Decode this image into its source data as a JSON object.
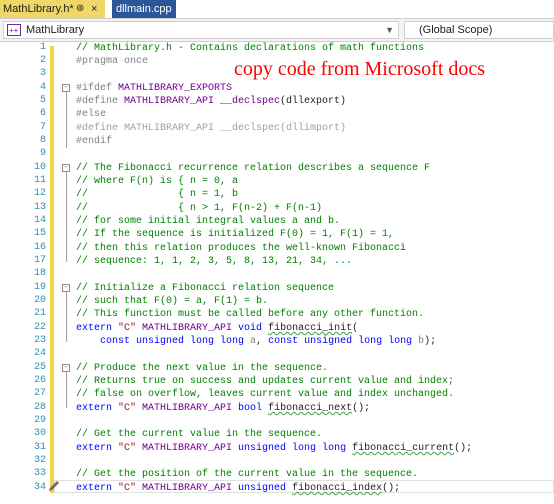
{
  "tabs": [
    {
      "label": "MathLibrary.h*",
      "active": true
    },
    {
      "label": "dllmain.cpp",
      "active": false
    }
  ],
  "nav": {
    "project": "MathLibrary",
    "scope": "(Global Scope)"
  },
  "annotation": "copy code from Microsoft docs",
  "line_numbers": [
    "1",
    "2",
    "3",
    "4",
    "5",
    "6",
    "7",
    "8",
    "9",
    "10",
    "11",
    "12",
    "13",
    "14",
    "15",
    "16",
    "17",
    "18",
    "19",
    "20",
    "21",
    "22",
    "23",
    "24",
    "25",
    "26",
    "27",
    "28",
    "29",
    "30",
    "31",
    "32",
    "33",
    "34"
  ],
  "lines": {
    "l1": "// MathLibrary.h - Contains declarations of math functions",
    "l2": "#pragma once",
    "l4a": "#ifdef ",
    "l4b": "MATHLIBRARY_EXPORTS",
    "l5a": "#define ",
    "l5b": "MATHLIBRARY_API",
    "l5c": " __declspec",
    "l5d": "(dllexport)",
    "l6": "#else",
    "l7": "#define MATHLIBRARY_API __declspec(dllimport)",
    "l8": "#endif",
    "l10": "// The Fibonacci recurrence relation describes a sequence F",
    "l11": "// where F(n) is { n = 0, a",
    "l12": "//               { n = 1, b",
    "l13": "//               { n > 1, F(n-2) + F(n-1)",
    "l14": "// for some initial integral values a and b.",
    "l15": "// If the sequence is initialized F(0) = 1, F(1) = 1,",
    "l16": "// then this relation produces the well-known Fibonacci",
    "l17": "// sequence: 1, 1, 2, 3, 5, 8, 13, 21, 34, ...",
    "l19": "// Initialize a Fibonacci relation sequence",
    "l20": "// such that F(0) = a, F(1) = b.",
    "l21": "// This function must be called before any other function.",
    "l22a": "extern ",
    "l22b": "\"C\"",
    "l22c": " MATHLIBRARY_API",
    "l22d": " void ",
    "l22e": "fibonacci_init",
    "l22f": "(",
    "l23a": "    const unsigned long long ",
    "l23b": "a",
    "l23c": ", ",
    "l23d": "const unsigned long long ",
    "l23e": "b",
    "l23f": ");",
    "l25": "// Produce the next value in the sequence.",
    "l26": "// Returns true on success and updates current value and index;",
    "l27": "// false on overflow, leaves current value and index unchanged.",
    "l28a": "extern ",
    "l28b": "\"C\"",
    "l28c": " MATHLIBRARY_API",
    "l28d": " bool ",
    "l28e": "fibonacci_next",
    "l28f": "();",
    "l30": "// Get the current value in the sequence.",
    "l31a": "extern ",
    "l31b": "\"C\"",
    "l31c": " MATHLIBRARY_API",
    "l31d": " unsigned long long ",
    "l31e": "fibonacci_current",
    "l31f": "();",
    "l33": "// Get the position of the current value in the sequence.",
    "l34a": "extern ",
    "l34b": "\"C\"",
    "l34c": " MATHLIBRARY_API",
    "l34d": " unsigned ",
    "l34e": "fibonacci_index",
    "l34f": "();"
  }
}
